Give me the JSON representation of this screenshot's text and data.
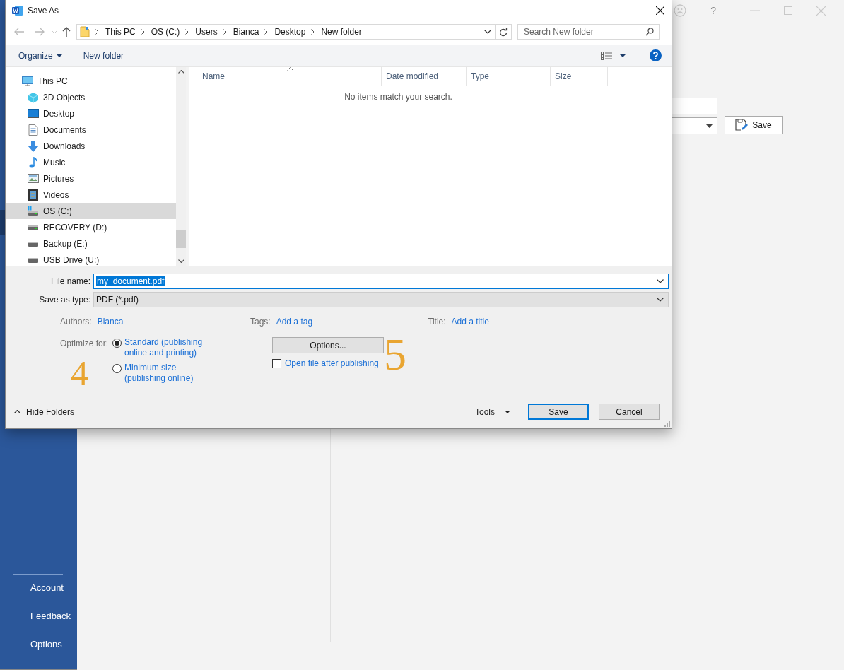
{
  "backstage": {
    "nav_items": [
      {
        "label": "Account"
      },
      {
        "label": "Feedback"
      },
      {
        "label": "Options"
      }
    ],
    "help_mark": "?",
    "save_button": "Save"
  },
  "dialog": {
    "title": "Save As",
    "breadcrumb": [
      "This PC",
      "OS (C:)",
      "Users",
      "Bianca",
      "Desktop",
      "New folder"
    ],
    "search": {
      "placeholder": "Search New folder"
    },
    "toolbar": {
      "organize": "Organize",
      "new_folder": "New folder"
    },
    "tree": [
      {
        "label": "This PC",
        "kind": "pc",
        "selected": false,
        "children": [
          {
            "label": "3D Objects",
            "kind": "cube",
            "selected": false
          },
          {
            "label": "Desktop",
            "kind": "desktop",
            "selected": false
          },
          {
            "label": "Documents",
            "kind": "documents",
            "selected": false
          },
          {
            "label": "Downloads",
            "kind": "downloads",
            "selected": false
          },
          {
            "label": "Music",
            "kind": "music",
            "selected": false
          },
          {
            "label": "Pictures",
            "kind": "pictures",
            "selected": false
          },
          {
            "label": "Videos",
            "kind": "videos",
            "selected": false
          },
          {
            "label": "OS (C:)",
            "kind": "os-drive",
            "selected": true
          },
          {
            "label": "RECOVERY (D:)",
            "kind": "drive",
            "selected": false
          },
          {
            "label": "Backup (E:)",
            "kind": "drive",
            "selected": false
          },
          {
            "label": "USB Drive (U:)",
            "kind": "drive",
            "selected": false
          }
        ]
      }
    ],
    "columns": [
      "Name",
      "Date modified",
      "Type",
      "Size"
    ],
    "empty_message": "No items match your search.",
    "file_name": {
      "label": "File name:",
      "value": "my_document.pdf"
    },
    "save_as_type": {
      "label": "Save as type:",
      "value": "PDF (*.pdf)"
    },
    "meta": [
      {
        "label": "Authors:",
        "value": "Bianca"
      },
      {
        "label": "Tags:",
        "value": "Add a tag"
      },
      {
        "label": "Title:",
        "value": "Add a title"
      }
    ],
    "optimize": {
      "label": "Optimize for:",
      "options": [
        {
          "label": "Standard (publishing online and printing)",
          "selected": true
        },
        {
          "label": "Minimum size (publishing online)",
          "selected": false
        }
      ]
    },
    "options_button": "Options...",
    "open_after": {
      "label": "Open file after publishing",
      "checked": false
    },
    "hide_folders": "Hide Folders",
    "tools": "Tools",
    "save": "Save",
    "cancel": "Cancel"
  },
  "annotations": [
    "4",
    "5"
  ]
}
